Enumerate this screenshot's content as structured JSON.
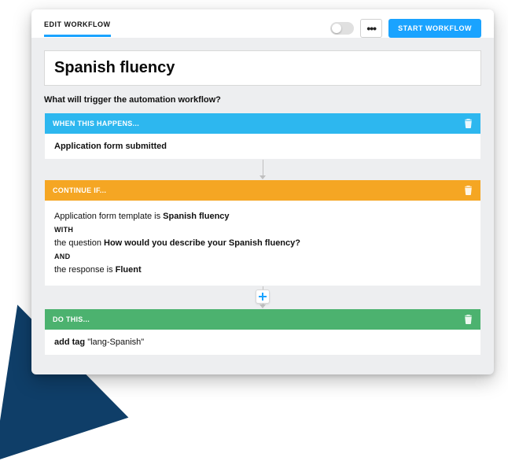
{
  "header": {
    "tab_label": "EDIT WORKFLOW",
    "start_button": "START WORKFLOW"
  },
  "workflow": {
    "title": "Spanish fluency",
    "prompt": "What will trigger the automation workflow?"
  },
  "trigger": {
    "header": "WHEN THIS HAPPENS...",
    "text": "Application form submitted"
  },
  "condition": {
    "header": "CONTINUE IF...",
    "line1_prefix": "Application form template is ",
    "line1_value": "Spanish fluency",
    "with": "WITH",
    "line2_prefix": "the question ",
    "line2_value": "How would you describe your Spanish fluency?",
    "and": "AND",
    "line3_prefix": "the response is ",
    "line3_value": "Fluent"
  },
  "action": {
    "header": "DO THIS...",
    "label": "add tag",
    "value": "\"lang-Spanish\""
  },
  "icons": {
    "trash": "trash-icon",
    "plus": "add-step-icon",
    "menu": "more-menu-icon",
    "toggle": "enable-toggle"
  }
}
